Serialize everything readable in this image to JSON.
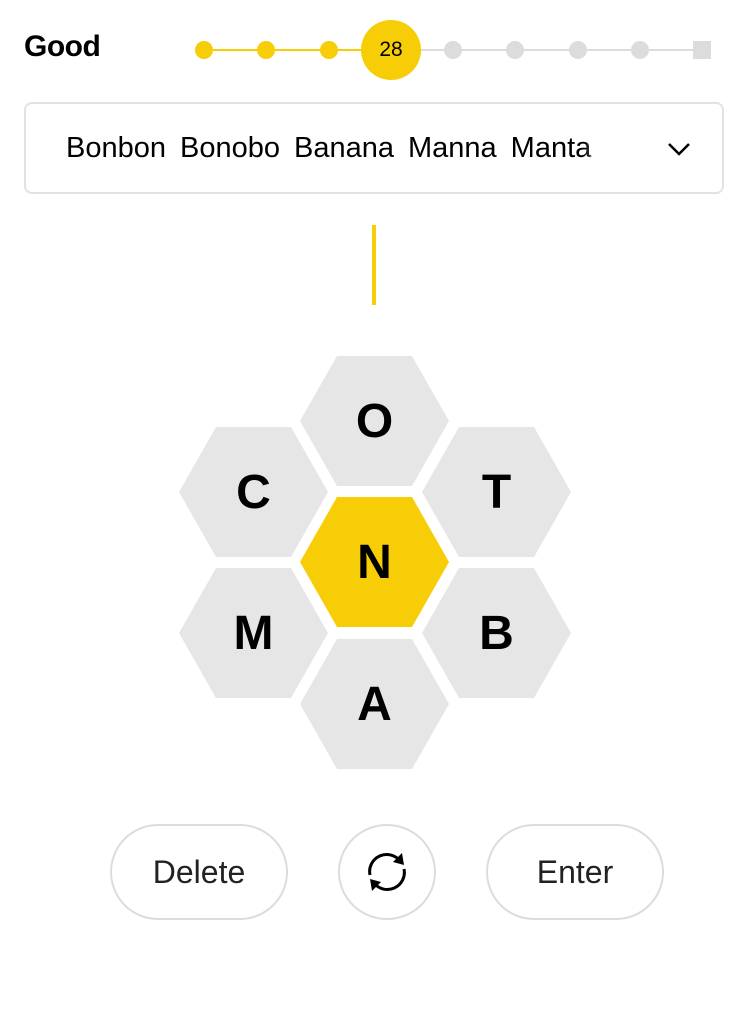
{
  "rank": {
    "label": "Good"
  },
  "progress": {
    "score": "28",
    "current_level_index": 3,
    "levels_total": 9,
    "colors": {
      "filled": "#f7cd08",
      "empty": "#dcdcdc"
    }
  },
  "found_words": {
    "words": [
      "Bonbon",
      "Bonobo",
      "Banana",
      "Manna",
      "Manta"
    ],
    "toggle_icon": "chevron-down-icon"
  },
  "input": {
    "current_word": ""
  },
  "hive": {
    "center_letter": "N",
    "outer_letters": {
      "top": "O",
      "upper_left": "C",
      "upper_right": "T",
      "lower_left": "M",
      "lower_right": "B",
      "bottom": "A"
    },
    "colors": {
      "center": "#f7cd08",
      "outer": "#e6e6e6"
    }
  },
  "controls": {
    "delete_label": "Delete",
    "shuffle_icon": "shuffle-icon",
    "enter_label": "Enter"
  }
}
